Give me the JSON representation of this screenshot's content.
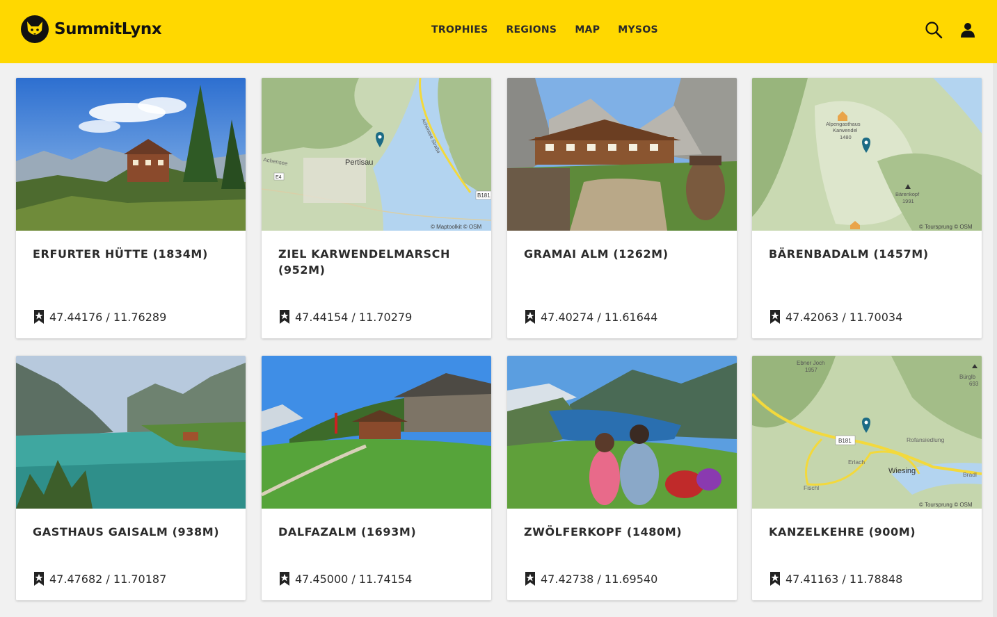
{
  "brand": {
    "name": "SummitLynx"
  },
  "nav": [
    {
      "label": "TROPHIES"
    },
    {
      "label": "REGIONS"
    },
    {
      "label": "MAP"
    },
    {
      "label": "MYSOS"
    }
  ],
  "header_icons": [
    "search-icon",
    "user-icon"
  ],
  "colors": {
    "header": "#ffd800",
    "map_pin": "#1c6b85",
    "road": "#f2da3a"
  },
  "cards": [
    {
      "title": "ERFURTER HÜTTE (1834M)",
      "coords": "47.44176 / 11.76289",
      "image": "photo-mountain-hut"
    },
    {
      "title": "ZIEL KARWENDELMARSCH (952M)",
      "coords": "47.44154 / 11.70279",
      "image": "map",
      "map_labels": [
        "Pertisau",
        "B181",
        "E4",
        "Achensee",
        "Achensee Straße"
      ],
      "attribution": "© Maptoolkit © OSM"
    },
    {
      "title": "GRAMAI ALM (1262M)",
      "coords": "47.40274 / 11.61644",
      "image": "photo-alpine-inn"
    },
    {
      "title": "BÄRENBADALM (1457M)",
      "coords": "47.42063 / 11.70034",
      "image": "map",
      "map_labels": [
        "Alpengasthaus",
        "Karwendel",
        "1480",
        "Bärenkopf",
        "1991"
      ],
      "attribution": "© Toursprung © OSM"
    },
    {
      "title": "GASTHAUS GAISALM (938M)",
      "coords": "47.47682 / 11.70187",
      "image": "photo-lake"
    },
    {
      "title": "DALFAZALM (1693M)",
      "coords": "47.45000 / 11.74154",
      "image": "photo-meadow-hut"
    },
    {
      "title": "ZWÖLFERKOPF (1480M)",
      "coords": "47.42738 / 11.69540",
      "image": "photo-couple-lake"
    },
    {
      "title": "KANZELKEHRE (900M)",
      "coords": "47.41163 / 11.78848",
      "image": "map",
      "map_labels": [
        "Ebner Joch",
        "1957",
        "Bürglb",
        "693",
        "B181",
        "Rofansiedlung",
        "Erlach",
        "Wiesing",
        "Fischl",
        "Bradl"
      ],
      "attribution": "© Toursprung © OSM"
    }
  ]
}
